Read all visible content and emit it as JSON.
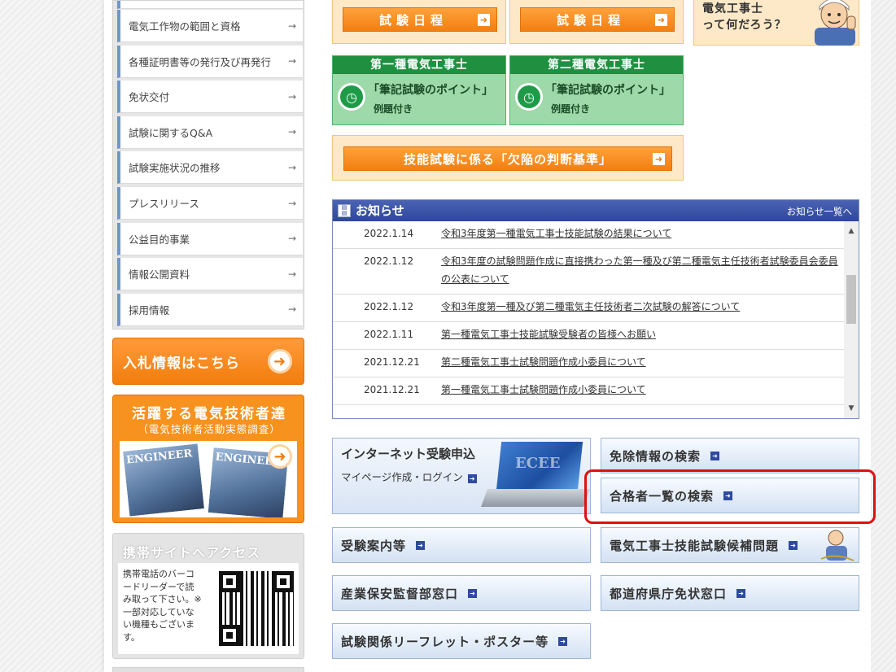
{
  "sidebar": {
    "items": [
      {
        "label": "電気工作物の範囲と資格"
      },
      {
        "label": "各種証明書等の発行及び再発行"
      },
      {
        "label": "免状交付"
      },
      {
        "label": "試験に関するQ&A"
      },
      {
        "label": "試験実施状況の推移"
      },
      {
        "label": "プレスリリース"
      },
      {
        "label": "公益目的事業"
      },
      {
        "label": "情報公開資料"
      },
      {
        "label": "採用情報"
      }
    ],
    "arrow_glyph": "→",
    "bid_banner": "入札情報はこちら",
    "engineer_banner": {
      "title": "活躍する電気技術者達",
      "subtitle": "（電気技術者活動実態調査）",
      "magazine_text": "ENGINEER"
    },
    "mobile": {
      "title": "携帯サイトへアクセス",
      "text": "携帯電話のバーコードリーダーで読み取って下さい。※一部対応していない機種もございます。"
    }
  },
  "main": {
    "schedule_buttons": [
      {
        "label": "試験日程"
      },
      {
        "label": "試験日程"
      }
    ],
    "what_is": {
      "label": "電気工事士\nって何だろう？"
    },
    "written_points": [
      {
        "header": "第一種電気工事士",
        "title": "「筆記試験のポイント」",
        "sub": "例題付き"
      },
      {
        "header": "第二種電気工事士",
        "title": "「筆記試験のポイント」",
        "sub": "例題付き"
      }
    ],
    "defect_button": {
      "label": "技能試験に係る「欠陥の判断基準」"
    },
    "news": {
      "title": "お知らせ",
      "all_link": "お知らせ一覧へ",
      "items": [
        {
          "date": "2022.1.14",
          "text": "令和3年度第一種電気工事士技能試験の結果について"
        },
        {
          "date": "2022.1.12",
          "text": "令和3年度の試験問題作成に直接携わった第一種及び第二種電気主任技術者試験委員会委員の公表について"
        },
        {
          "date": "2022.1.12",
          "text": "令和3年度第一種及び第二種電気主任技術者二次試験の解答について"
        },
        {
          "date": "2022.1.11",
          "text": "第一種電気工事士技能試験受験者の皆様へお願い"
        },
        {
          "date": "2021.12.21",
          "text": "第二種電気工事士試験問題作成小委員について"
        },
        {
          "date": "2021.12.21",
          "text": "第一種電気工事士試験問題作成小委員について"
        }
      ]
    },
    "internet": {
      "title": "インターネット受験申込",
      "sub": "マイページ作成・ログイン",
      "laptop_text": "ECEE"
    },
    "links": {
      "exemption": "免除情報の検索",
      "passers": "合格者一覧の検索",
      "exam_guide": "受験案内等",
      "skill_candidates": "電気工事士技能試験候補問題",
      "safety_office": "産業保安監督部窓口",
      "prefecture_office": "都道府県庁免状窓口",
      "leaflet": "試験関係リーフレット・ポスター等"
    }
  },
  "colors": {
    "accent_orange": "#f27f11",
    "accent_green": "#1f8f40",
    "news_blue": "#2f479a",
    "highlight_red": "#e01010"
  }
}
